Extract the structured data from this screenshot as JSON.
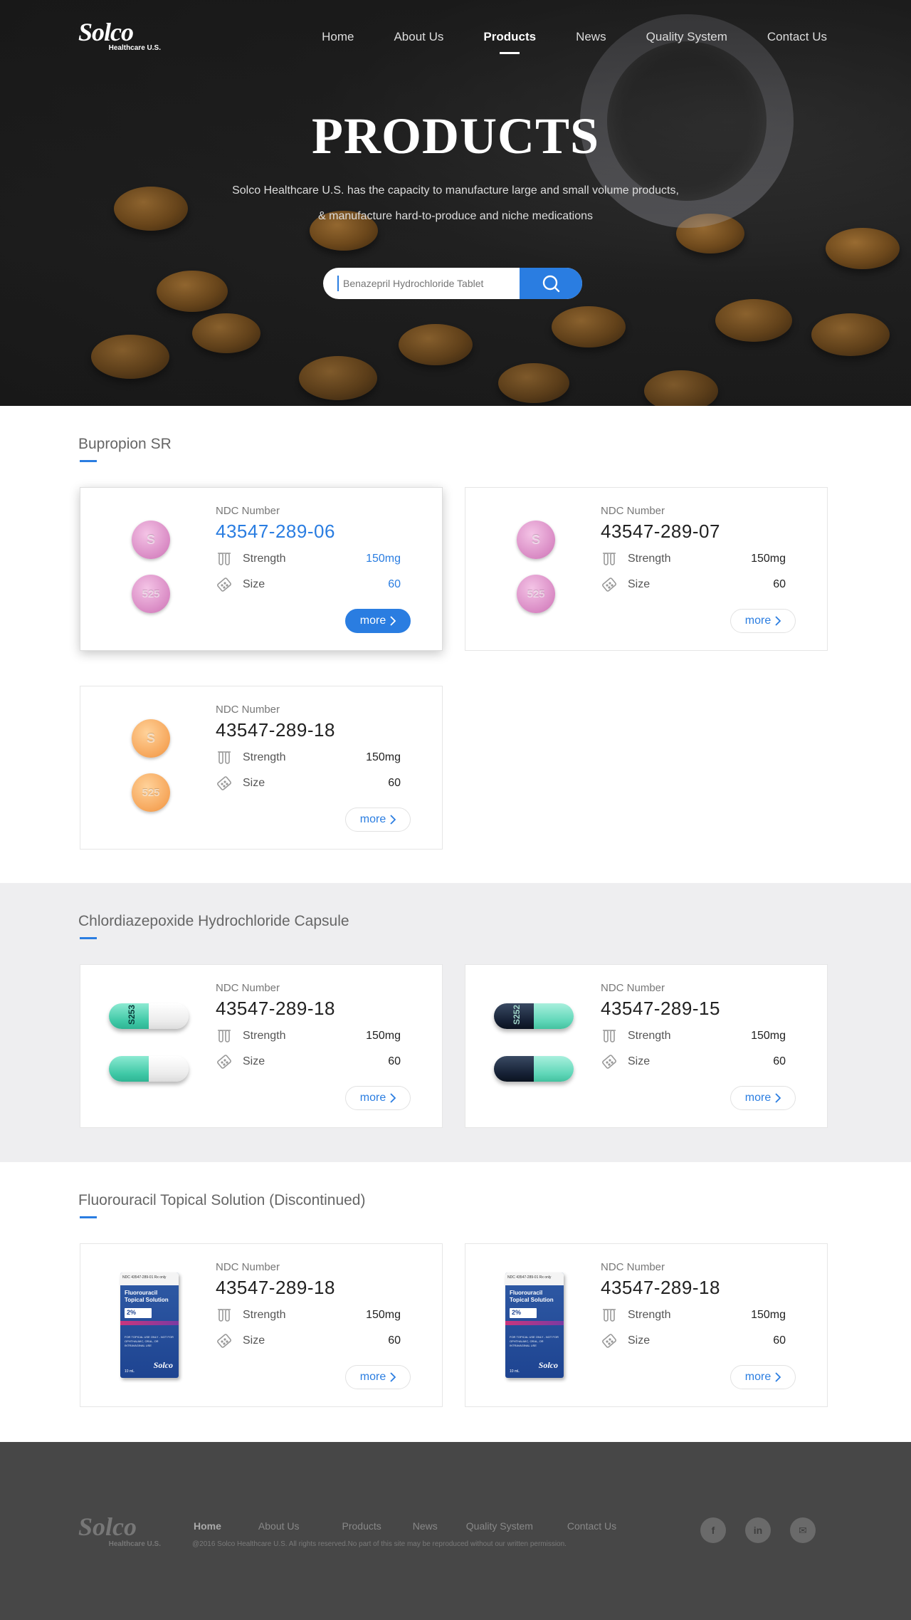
{
  "brand": {
    "logo_word": "Solco",
    "logo_sub": "Healthcare U.S."
  },
  "nav": {
    "items": [
      {
        "label": "Home"
      },
      {
        "label": "About Us"
      },
      {
        "label": "Products"
      },
      {
        "label": "News"
      },
      {
        "label": "Quality System"
      },
      {
        "label": "Contact Us"
      }
    ],
    "active": "Products"
  },
  "hero": {
    "title": "PRODUCTS",
    "subtitle_line1": "Solco Healthcare U.S. has the capacity to manufacture large and small volume products,",
    "subtitle_line2": "& manufacture hard-to-produce and niche medications"
  },
  "search": {
    "placeholder": "Benazepril Hydrochloride Tablet",
    "icon": "search-icon"
  },
  "labels": {
    "ndc": "NDC  Number",
    "strength": "Strength",
    "size": "Size",
    "more": "more"
  },
  "sections": [
    {
      "title": "Bupropion SR",
      "products": [
        {
          "ndc": "43547-289-06",
          "strength": "150mg",
          "size": "60",
          "pill_color": "pink",
          "imprint_top": "S",
          "imprint_bottom": "525",
          "highlighted": true
        },
        {
          "ndc": "43547-289-07",
          "strength": "150mg",
          "size": "60",
          "pill_color": "pink",
          "imprint_top": "S",
          "imprint_bottom": "525",
          "highlighted": false
        },
        {
          "ndc": "43547-289-18",
          "strength": "150mg",
          "size": "60",
          "pill_color": "orange",
          "imprint_top": "S",
          "imprint_bottom": "525",
          "highlighted": false
        }
      ]
    },
    {
      "title": "Chlordiazepoxide Hydrochloride Capsule",
      "products": [
        {
          "ndc": "43547-289-18",
          "strength": "150mg",
          "size": "60",
          "capsule_colors": [
            "#55d6b6",
            "#f4f4f4"
          ],
          "imprint": "S253"
        },
        {
          "ndc": "43547-289-15",
          "strength": "150mg",
          "size": "60",
          "capsule_colors": [
            "#142033",
            "#6fdcc0"
          ],
          "imprint": "S252"
        }
      ]
    },
    {
      "title": "Fluorouracil Topical Solution (Discontinued)",
      "products": [
        {
          "ndc": "43547-289-18",
          "strength": "150mg",
          "size": "60",
          "box_name_line1": "Fluorouracil",
          "box_name_line2": "Topical Solution",
          "box_pct": "2%",
          "box_top": "NDC 43547-289-01   Rx only",
          "box_note": "FOR TOPICAL USE ONLY - NOT FOR OPHTHALMIC, ORAL, OR INTRAVAGINAL USE",
          "box_ml": "10 mL",
          "box_logo": "Solco"
        },
        {
          "ndc": "43547-289-18",
          "strength": "150mg",
          "size": "60",
          "box_name_line1": "Fluorouracil",
          "box_name_line2": "Topical Solution",
          "box_pct": "2%",
          "box_top": "NDC 43547-289-01   Rx only",
          "box_note": "FOR TOPICAL USE ONLY - NOT FOR OPHTHALMIC, ORAL, OR INTRAVAGINAL USE",
          "box_ml": "10 mL",
          "box_logo": "Solco"
        }
      ]
    }
  ],
  "footer": {
    "nav": [
      "Home",
      "About Us",
      "Products",
      "News",
      "Quality System",
      "Contact Us"
    ],
    "copyright": "@2016 Solco Healthcare U.S. All rights reserved.No part of this site may be reproduced without our written permission.",
    "social": [
      {
        "label": "f"
      },
      {
        "label": "in"
      },
      {
        "label": "✉"
      }
    ]
  },
  "colors": {
    "accent": "#2a7de1",
    "footer_bg": "#474747",
    "section_alt_bg": "#eeeef0"
  }
}
